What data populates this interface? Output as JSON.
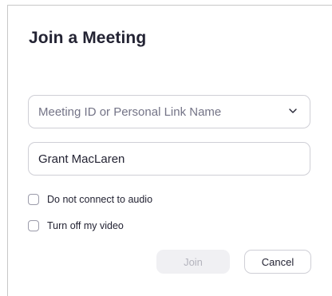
{
  "dialog": {
    "title": "Join a Meeting",
    "meeting_id": {
      "placeholder": "Meeting ID or Personal Link Name",
      "value": ""
    },
    "name": {
      "value": "Grant MacLaren",
      "placeholder": ""
    },
    "options": [
      {
        "label": "Do not connect to audio",
        "checked": false
      },
      {
        "label": "Turn off my video",
        "checked": false
      }
    ],
    "join_label": "Join",
    "cancel_label": "Cancel"
  },
  "colors": {
    "text": "#232333",
    "placeholder": "#747487",
    "border": "#cfcfd6",
    "disabled_bg": "#f0f0f3",
    "disabled_text": "#b4b4bd"
  },
  "icons": {
    "dropdown": "chevron-down-icon"
  }
}
